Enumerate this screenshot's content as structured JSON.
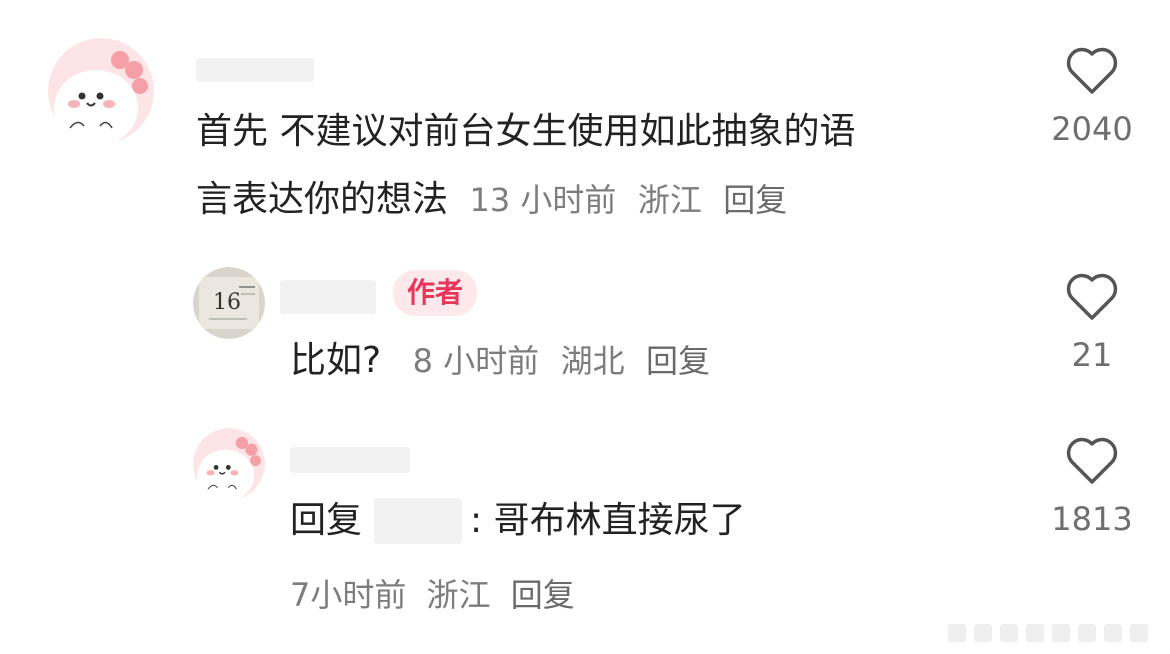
{
  "comments": [
    {
      "text_line1": "首先 不建议对前台女生使用如此抽象的语",
      "text_line2": "言表达你的想法",
      "time": "13 小时前",
      "region": "浙江",
      "reply_label": "回复",
      "likes": "2040"
    },
    {
      "author_badge": "作者",
      "text": "比如?",
      "time": "8 小时前",
      "region": "湖北",
      "reply_label": "回复",
      "likes": "21",
      "avatar_text": "16"
    },
    {
      "reply_prefix": "回复",
      "text": ": 哥布林直接尿了",
      "time": "7小时前",
      "region": "浙江",
      "reply_label": "回复",
      "likes": "1813"
    }
  ],
  "colors": {
    "badge_text": "#e8365a",
    "badge_bg": "#fde9ec",
    "meta_text": "#7d7d7d",
    "avatar_bg": "#fde4e6"
  },
  "icons": [
    "dino-avatar-icon",
    "calendar-avatar-icon",
    "heart-icon"
  ]
}
